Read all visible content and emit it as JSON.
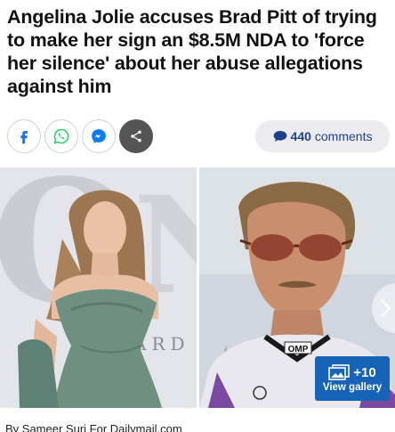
{
  "article": {
    "headline": "Angelina Jolie accuses Brad Pitt of trying to make her sign an $8.5M NDA to 'force her silence' about her abuse allegations against him",
    "byline": "By Sameer Suri For Dailymail.com"
  },
  "share": {
    "buttons": [
      {
        "name": "facebook",
        "icon": "facebook-icon",
        "color": "#1877f2"
      },
      {
        "name": "whatsapp",
        "icon": "whatsapp-icon",
        "color": "#25d366"
      },
      {
        "name": "messenger",
        "icon": "messenger-icon",
        "color": "#0a7cff"
      },
      {
        "name": "more",
        "icon": "share-icon",
        "color": "#555555"
      }
    ]
  },
  "comments": {
    "count": "440",
    "label": "comments",
    "color": "#1f3f8f"
  },
  "gallery": {
    "count": "+10",
    "label": "View gallery",
    "color": "#1763b8"
  },
  "photos": {
    "left_backdrop_letters": "ARD",
    "right_patch_text": "OMP"
  }
}
